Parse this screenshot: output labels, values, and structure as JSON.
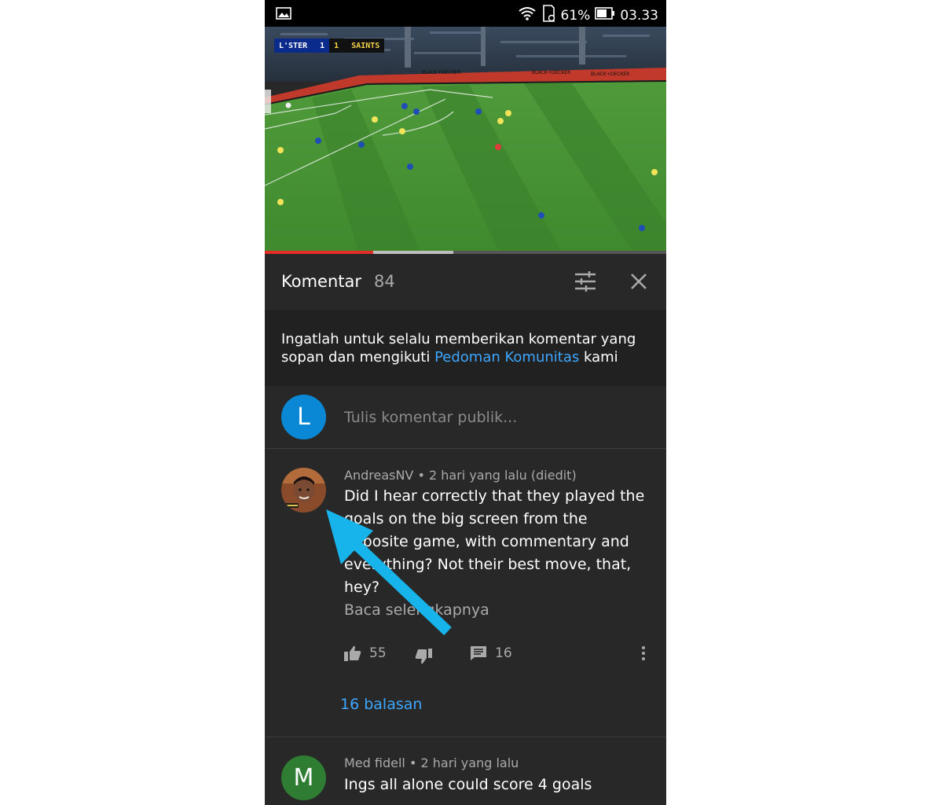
{
  "status_bar": {
    "battery_percent": "61%",
    "time": "03.33"
  },
  "video": {
    "scorebug": {
      "home_team": "L'STER",
      "home_score": "1",
      "away_score": "1",
      "away_team": "SAINTS"
    },
    "ad_board_text": "BLACK+DECKER",
    "progress": {
      "played_fraction": 0.27,
      "buffered_fraction": 0.47
    }
  },
  "comments_header": {
    "title": "Komentar",
    "count": "84"
  },
  "notice": {
    "text_before": "Ingatlah untuk selalu memberikan komentar yang sopan dan mengikuti ",
    "link": "Pedoman Komunitas",
    "text_after": " kami"
  },
  "composer": {
    "avatar_letter": "L",
    "placeholder": "Tulis komentar publik..."
  },
  "comments": [
    {
      "author": "AndreasNV",
      "time": "• 2 hari yang lalu (diedit)",
      "text": "Did I hear correctly that they played the goals on the big screen from the opposite game, with commentary and everything? Not their best move, that, hey?",
      "read_more": "Baca selengkapnya",
      "likes": "55",
      "reply_count": "16",
      "replies_link": "16 balasan"
    },
    {
      "avatar_letter": "M",
      "author": "Med fidell",
      "time": "• 2 hari yang lalu",
      "text": "Ings all alone could score 4 goals"
    }
  ],
  "colors": {
    "accent_blue": "#3ea6ff",
    "progress_red": "#e52d27",
    "arrow_blue": "#16b4ea",
    "avatar_L": "#0b88d5",
    "avatar_M": "#2e7d32"
  }
}
